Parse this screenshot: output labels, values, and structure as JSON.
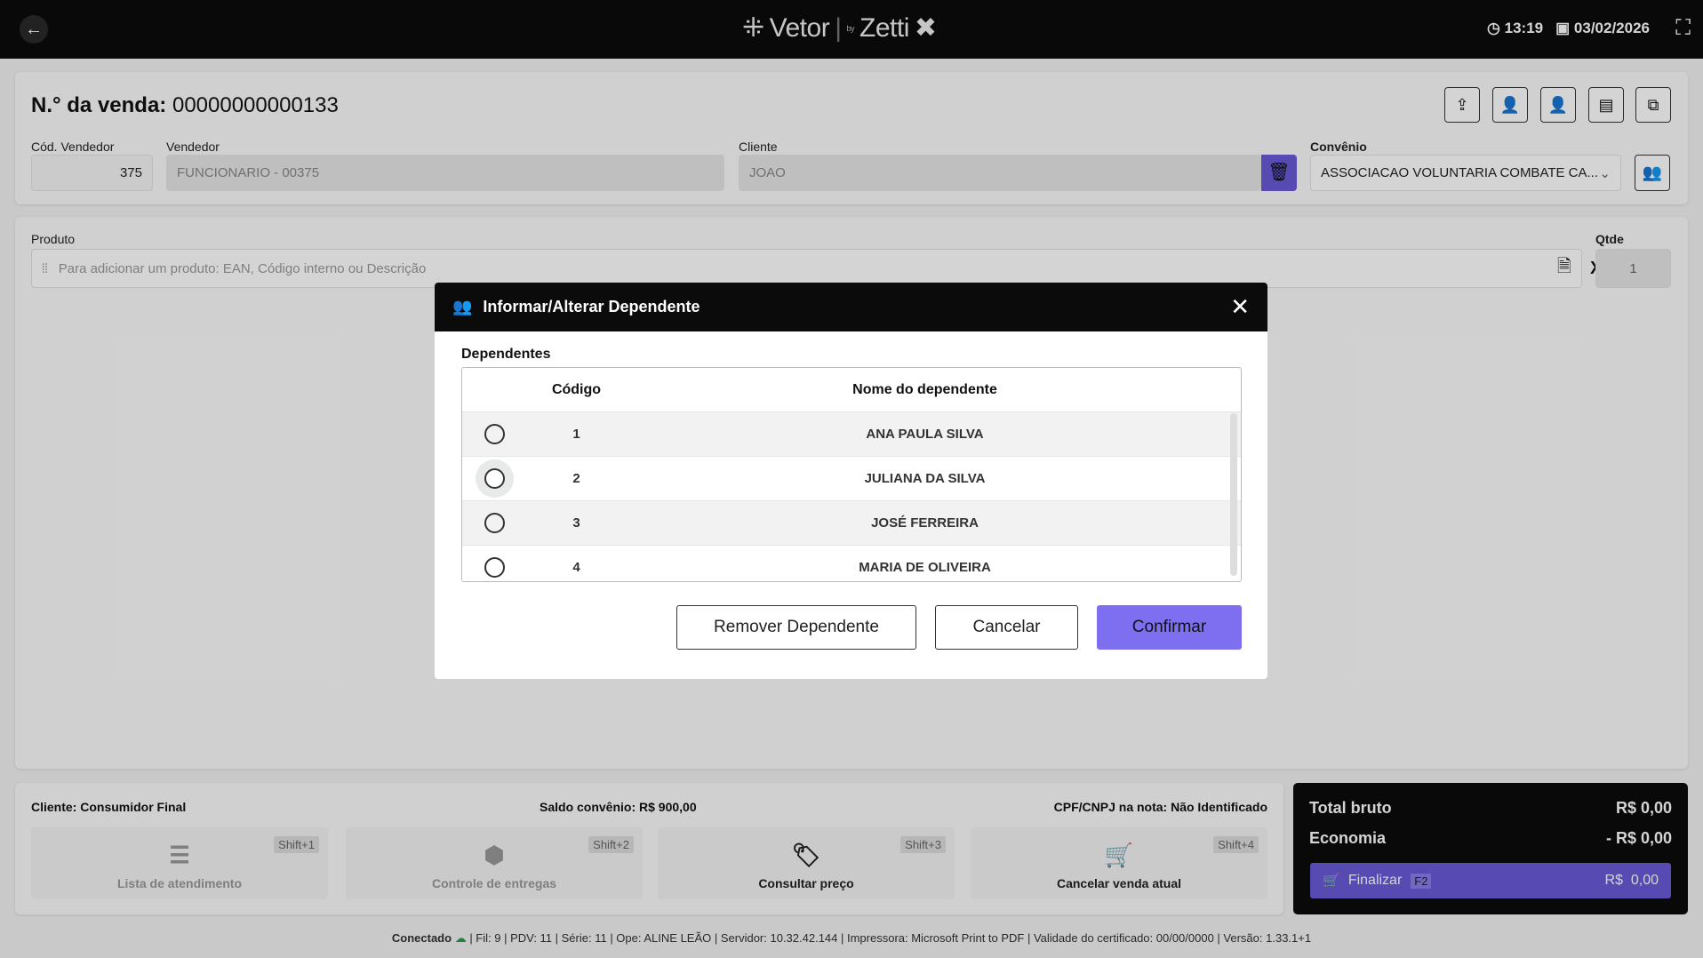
{
  "topbar": {
    "logo_main": "Vetor",
    "logo_by": "by",
    "logo_brand": "Zetti",
    "time": "13:19",
    "date": "03/02/2026"
  },
  "header": {
    "sale_label": "N.° da venda:",
    "sale_number": "00000000000133",
    "cod_vendedor_label": "Cód. Vendedor",
    "cod_vendedor": "375",
    "vendedor_label": "Vendedor",
    "vendedor": "FUNCIONARIO - 00375",
    "cliente_label": "Cliente",
    "cliente": "JOAO",
    "convenio_label": "Convênio",
    "convenio": "ASSOCIACAO VOLUNTARIA COMBATE CA..."
  },
  "produto": {
    "label": "Produto",
    "placeholder": "Para adicionar um produto: EAN, Código interno ou Descrição",
    "x": "X",
    "qtde_label": "Qtde",
    "qtde": "1"
  },
  "modal": {
    "title": "Informar/Alterar Dependente",
    "section": "Dependentes",
    "columns": [
      "Código",
      "Nome do dependente"
    ],
    "rows": [
      {
        "code": "1",
        "name": "ANA PAULA SILVA"
      },
      {
        "code": "2",
        "name": "JULIANA DA SILVA"
      },
      {
        "code": "3",
        "name": "JOSÉ FERREIRA"
      },
      {
        "code": "4",
        "name": "MARIA DE OLIVEIRA"
      }
    ],
    "remove": "Remover Dependente",
    "cancel": "Cancelar",
    "confirm": "Confirmar"
  },
  "footer": {
    "cliente": "Cliente: Consumidor Final",
    "saldo": "Saldo convênio: R$ 900,00",
    "cpf": "CPF/CNPJ na nota: Não Identificado",
    "shortcuts": [
      {
        "label": "Lista de atendimento",
        "key": "Shift+1"
      },
      {
        "label": "Controle de entregas",
        "key": "Shift+2"
      },
      {
        "label": "Consultar preço",
        "key": "Shift+3"
      },
      {
        "label": "Cancelar venda atual",
        "key": "Shift+4"
      }
    ]
  },
  "totals": {
    "bruto_label": "Total bruto",
    "bruto": "R$ 0,00",
    "economia_label": "Economia",
    "economia": "- R$ 0,00",
    "finalizar": "Finalizar",
    "finalizar_key": "F2",
    "finalizar_value": "R$  0,00"
  },
  "status": {
    "connected": "Conectado",
    "info": "| Fil: 9 | PDV: 11 | Série: 11 | Ope: ALINE LEÃO | Servidor: 10.32.42.144 | Impressora: Microsoft Print to PDF | Validade do certificado: 00/00/0000 | Versão: 1.33.1+1"
  },
  "colors": {
    "accent": "#7e6ff0",
    "topbar": "#0b0b0b"
  }
}
